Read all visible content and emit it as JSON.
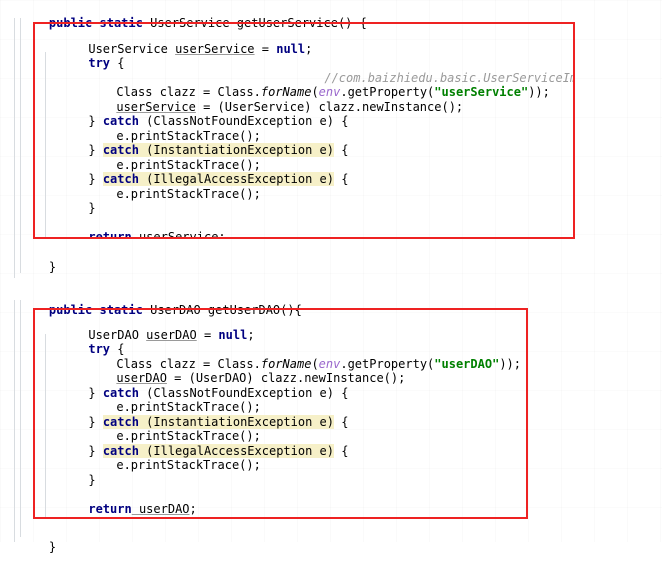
{
  "document": {
    "language": "Java",
    "background_color": "#ffffff",
    "font_family_kind": "monospace",
    "annotation_color": "#ee2222",
    "highlight_color": "#f6f0c8",
    "keyword_color": "#000080",
    "string_color": "#008000",
    "comment_color": "#9a9a9a",
    "field_color": "#9966cc"
  },
  "block_one": {
    "signature": {
      "kw_public": "public",
      "kw_static": "static",
      "return_type": "UserService",
      "name_and_paren": " getUserService() {"
    },
    "lines": {
      "decl_type": "UserService ",
      "decl_var": "userService",
      "decl_assign": " = ",
      "decl_null": "null",
      "decl_semi": ";",
      "try_kw": "try",
      "try_brace": " {",
      "comment": "//com.baizhiedu.basic.UserServiceImpl",
      "class_decl_a": "Class clazz = Class.",
      "class_decl_forname": "forName",
      "class_decl_b": "(",
      "class_decl_env": "env",
      "class_decl_c": ".getProperty(",
      "class_decl_str": "\"userService\"",
      "class_decl_d": "));",
      "assign_var": "userService",
      "assign_rest": " = (UserService) clazz.newInstance();",
      "catch1_brace": "} ",
      "catch1_kw": "catch",
      "catch1_rest": " (ClassNotFoundException e) {",
      "print1": "e.printStackTrace();",
      "catch2_brace": "} ",
      "catch2_kw": "catch",
      "catch2_rest": " (InstantiationException e)",
      "catch2_tail": " {",
      "print2": "e.printStackTrace();",
      "catch3_brace": "} ",
      "catch3_kw": "catch",
      "catch3_rest": " (IllegalAccessException e)",
      "catch3_tail": " {",
      "print3": "e.printStackTrace();",
      "close_try": "}",
      "return_kw": "return",
      "return_var": " userService",
      "return_semi": ";"
    },
    "method_close_brace": "}"
  },
  "block_two": {
    "signature": {
      "kw_public": "public",
      "kw_static": "static",
      "return_type": "UserDAO",
      "name_and_paren": " getUserDAO(){"
    },
    "lines": {
      "decl_type": "UserDAO ",
      "decl_var": "userDAO",
      "decl_assign": " = ",
      "decl_null": "null",
      "decl_semi": ";",
      "try_kw": "try",
      "try_brace": " {",
      "class_decl_a": "Class clazz = Class.",
      "class_decl_forname": "forName",
      "class_decl_b": "(",
      "class_decl_env": "env",
      "class_decl_c": ".getProperty(",
      "class_decl_str": "\"userDAO\"",
      "class_decl_d": "));",
      "assign_var": "userDAO",
      "assign_rest": " = (UserDAO) clazz.newInstance();",
      "catch1_brace": "} ",
      "catch1_kw": "catch",
      "catch1_rest": " (ClassNotFoundException e) {",
      "print1": "e.printStackTrace();",
      "catch2_brace": "} ",
      "catch2_kw": "catch",
      "catch2_rest": " (InstantiationException e)",
      "catch2_tail": " {",
      "print2": "e.printStackTrace();",
      "catch3_brace": "} ",
      "catch3_kw": "catch",
      "catch3_rest": " (IllegalAccessException e)",
      "catch3_tail": " {",
      "print3": "e.printStackTrace();",
      "close_try": "}",
      "return_kw": "return",
      "return_var": " userDAO",
      "return_semi": ";"
    },
    "method_close_brace": "}"
  }
}
